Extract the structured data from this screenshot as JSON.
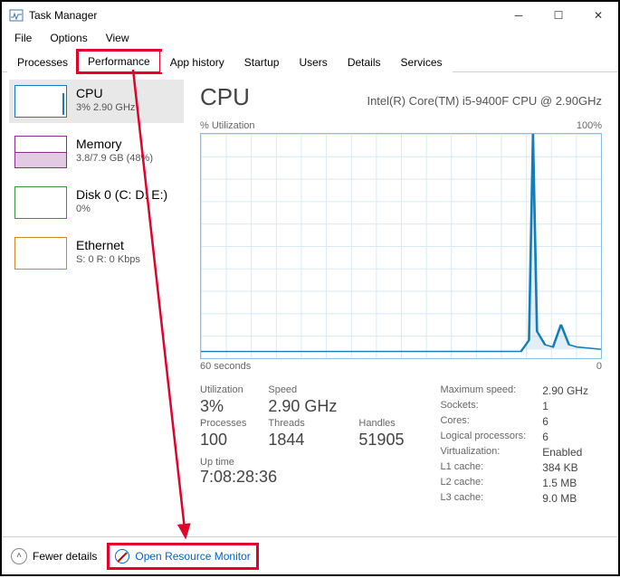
{
  "window": {
    "title": "Task Manager"
  },
  "menu": {
    "file": "File",
    "options": "Options",
    "view": "View"
  },
  "tabs": {
    "processes": "Processes",
    "performance": "Performance",
    "app_history": "App history",
    "startup": "Startup",
    "users": "Users",
    "details": "Details",
    "services": "Services"
  },
  "sidebar": {
    "cpu": {
      "name": "CPU",
      "sub": "3% 2.90 GHz"
    },
    "memory": {
      "name": "Memory",
      "sub": "3.8/7.9 GB (48%)"
    },
    "disk": {
      "name": "Disk 0 (C: D: E:)",
      "sub": "0%"
    },
    "eth": {
      "name": "Ethernet",
      "sub": "S: 0 R: 0 Kbps"
    }
  },
  "main": {
    "heading": "CPU",
    "model": "Intel(R) Core(TM) i5-9400F CPU @ 2.90GHz",
    "chart": {
      "top_left": "% Utilization",
      "top_right": "100%",
      "bottom_left": "60 seconds",
      "bottom_right": "0"
    },
    "stats_left": {
      "util_lbl": "Utilization",
      "util_val": "3%",
      "speed_lbl": "Speed",
      "speed_val": "2.90 GHz",
      "proc_lbl": "Processes",
      "proc_val": "100",
      "thread_lbl": "Threads",
      "thread_val": "1844",
      "handle_lbl": "Handles",
      "handle_val": "51905"
    },
    "stats_right": {
      "maxspeed_lbl": "Maximum speed:",
      "maxspeed_val": "2.90 GHz",
      "sockets_lbl": "Sockets:",
      "sockets_val": "1",
      "cores_lbl": "Cores:",
      "cores_val": "6",
      "lproc_lbl": "Logical processors:",
      "lproc_val": "6",
      "virt_lbl": "Virtualization:",
      "virt_val": "Enabled",
      "l1_lbl": "L1 cache:",
      "l1_val": "384 KB",
      "l2_lbl": "L2 cache:",
      "l2_val": "1.5 MB",
      "l3_lbl": "L3 cache:",
      "l3_val": "9.0 MB"
    },
    "uptime": {
      "lbl": "Up time",
      "val": "7:08:28:36"
    }
  },
  "footer": {
    "fewer": "Fewer details",
    "orm": "Open Resource Monitor"
  },
  "chart_data": {
    "type": "line",
    "title": "% Utilization",
    "xlabel": "seconds ago",
    "ylabel": "% Utilization",
    "ylim": [
      0,
      100
    ],
    "xlim": [
      60,
      0
    ],
    "x": [
      60,
      55,
      50,
      45,
      40,
      35,
      30,
      25,
      20,
      15,
      10,
      9,
      8,
      7,
      6,
      5,
      4,
      3,
      2,
      1,
      0
    ],
    "values": [
      3,
      3,
      3,
      3,
      3,
      3,
      3,
      3,
      3,
      3,
      4,
      8,
      100,
      12,
      6,
      5,
      15,
      6,
      5,
      4,
      4
    ]
  }
}
